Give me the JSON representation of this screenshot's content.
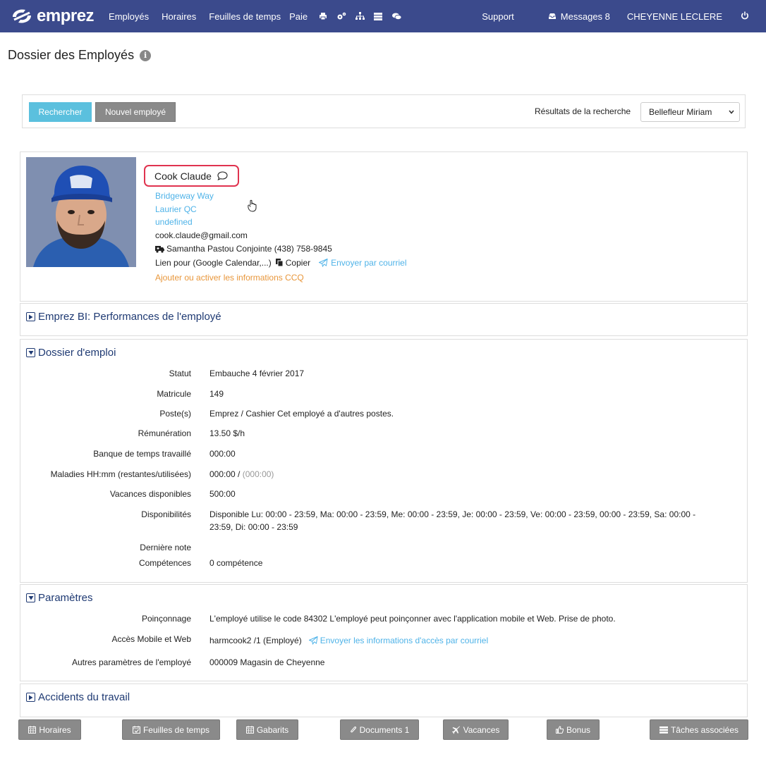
{
  "navbar": {
    "brand": "emprez",
    "items": [
      "Employés",
      "Horaires",
      "Feuilles de temps",
      "Paie"
    ],
    "support": "Support",
    "messages": "Messages 8",
    "user": "CHEYENNE LECLERE"
  },
  "page": {
    "title": "Dossier des Employés"
  },
  "search": {
    "search_button": "Rechercher",
    "new_button": "Nouvel employé",
    "results_label": "Résultats de la recherche",
    "results_selected": "Bellefleur Miriam"
  },
  "profile": {
    "name": "Cook Claude",
    "address_line1": "Bridgeway Way",
    "address_line2": "Laurier QC",
    "address_line3": "undefined",
    "email": "cook.claude@gmail.com",
    "emergency_contact": "Samantha Pastou Conjointe (438) 758-9845",
    "link_label": "Lien pour (Google Calendar,...)",
    "copy_label": "Copier",
    "send_email_label": "Envoyer par courriel",
    "ccq_link": "Ajouter ou activer les informations CCQ"
  },
  "sections": {
    "bi": "Emprez BI: Performances de l'employé",
    "dossier": "Dossier d'emploi",
    "parametres": "Paramètres",
    "accidents": "Accidents du travail"
  },
  "dossier": {
    "statut_label": "Statut",
    "statut_value": "Embauche 4 février 2017",
    "matricule_label": "Matricule",
    "matricule_value": "149",
    "postes_label": "Poste(s)",
    "postes_value": "Emprez / Cashier Cet employé a d'autres postes.",
    "remuneration_label": "Rémunération",
    "remuneration_value": "13.50 $/h",
    "banque_label": "Banque de temps travaillé",
    "banque_value": "000:00",
    "maladies_label": "Maladies HH:mm (restantes/utilisées)",
    "maladies_value": "000:00 /",
    "maladies_used": "(000:00)",
    "vacances_label": "Vacances disponibles",
    "vacances_value": "500:00",
    "dispo_label": "Disponibilités",
    "dispo_line1": "Disponible Lu: 00:00 - 23:59, Ma: 00:00 - 23:59, Me: 00:00 - 23:59, Je: 00:00 - 23:59, Ve: 00:00 - 23:59, 00:00 - 23:59, Sa: 00:00 -",
    "dispo_line2": "23:59, Di: 00:00 - 23:59",
    "note_label": "Dernière note",
    "competences_label": "Compétences",
    "competences_value": "0 compétence"
  },
  "parametres": {
    "poinconnage_label": "Poinçonnage",
    "poinconnage_value": "L'employé utilise le code 84302 L'employé peut poinçonner avec l'application mobile et Web. Prise de photo.",
    "acces_label": "Accès Mobile et Web",
    "acces_value": "harmcook2 /1 (Employé)",
    "acces_link": "Envoyer les informations d'accès par courriel",
    "autres_label": "Autres paramètres de l'employé",
    "autres_value": "000009 Magasin de Cheyenne"
  },
  "bottom_buttons": {
    "horaires": "Horaires",
    "feuilles": "Feuilles de temps",
    "gabarits": "Gabarits",
    "documents": "Documents 1",
    "vacances": "Vacances",
    "bonus": "Bonus",
    "taches": "Tâches associées"
  },
  "colors": {
    "navbar": "#3b4a8c",
    "link": "#4fb3e8",
    "highlight": "#e0334f",
    "section": "#1f3a73"
  }
}
